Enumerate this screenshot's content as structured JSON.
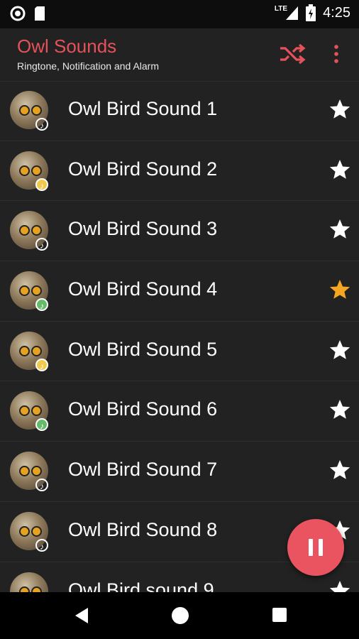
{
  "status_bar": {
    "time": "4:25",
    "network": "LTE"
  },
  "app_bar": {
    "title": "Owl Sounds",
    "subtitle": "Ringtone, Notification and Alarm"
  },
  "sounds": [
    {
      "label": "Owl Bird Sound 1",
      "favorite": false,
      "badge_color": "#ffffff"
    },
    {
      "label": "Owl Bird Sound 2",
      "favorite": false,
      "badge_color": "#f2c94c"
    },
    {
      "label": "Owl Bird Sound 3",
      "favorite": false,
      "badge_color": "#ffffff"
    },
    {
      "label": "Owl Bird Sound 4",
      "favorite": true,
      "badge_color": "#66bb6a"
    },
    {
      "label": "Owl Bird Sound 5",
      "favorite": false,
      "badge_color": "#f2c94c"
    },
    {
      "label": "Owl Bird Sound 6",
      "favorite": false,
      "badge_color": "#66bb6a"
    },
    {
      "label": "Owl Bird Sound 7",
      "favorite": false,
      "badge_color": "#ffffff"
    },
    {
      "label": "Owl Bird Sound 8",
      "favorite": false,
      "badge_color": "#ffffff"
    },
    {
      "label": "Owl Bird sound 9",
      "favorite": false,
      "badge_color": "#ffffff"
    }
  ],
  "colors": {
    "accent": "#e5525a",
    "fab": "#ea5460",
    "favorite_star": "#f5a623",
    "star": "#ffffff"
  },
  "icons": {
    "shuffle": "shuffle-icon",
    "more": "more-vert-icon",
    "fab": "pause-icon"
  }
}
